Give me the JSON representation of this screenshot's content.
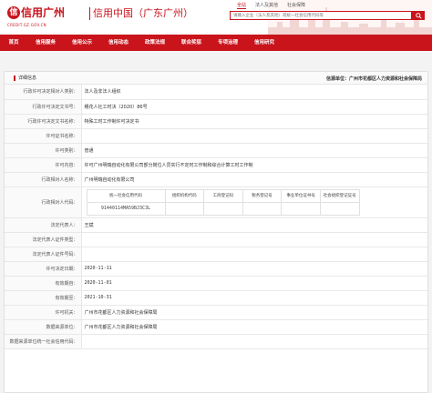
{
  "header": {
    "logo_char": "信",
    "logo_text": "信用广州",
    "logo_sub": "CREDIT.GZ.GOV.CN",
    "site_name": "信用中国（广东广州）",
    "top_tabs": [
      "全站",
      "法人及其他",
      "社会保障"
    ],
    "search_placeholder": "请输入企业（法人及其他）或统一社会信用代码等"
  },
  "nav": {
    "items": [
      "首页",
      "信用服务",
      "信用公示",
      "信用动态",
      "政策法规",
      "联合奖惩",
      "专项治理",
      "信用研究"
    ]
  },
  "panel": {
    "title": "详细信息",
    "unit": "信源单位：广州市花都区人力资源和社会保障局"
  },
  "rows": [
    {
      "label": "行政许可决定相对人类别：",
      "value": "法人及非法人组织"
    },
    {
      "label": "行政许可决定文书号：",
      "value": "穗花人社工时决（2020）86号"
    },
    {
      "label": "行政许可决定文书名称：",
      "value": "特殊工时工作制许可决定书"
    },
    {
      "label": "许可证书名称：",
      "value": ""
    },
    {
      "label": "许可类别：",
      "value": "普通"
    },
    {
      "label": "许可内容：",
      "value": "许可广州明瑞自动化有限公司部分岗位人员实行不定时工作制和综合计算工时工作制"
    },
    {
      "label": "行政相对人名称：",
      "value": "广州明瑞自动化有限公司"
    }
  ],
  "code_row": {
    "label": "行政相对人代码：",
    "headers": [
      "统一社会信用代码",
      "组织机构代码",
      "工商登记码",
      "税务登记号",
      "事业单位证书号",
      "社会组织登记证号"
    ],
    "values": [
      "91440114MA59BJ3C3L",
      "",
      "",
      "",
      "",
      ""
    ]
  },
  "rows2": [
    {
      "label": "法定代表人：",
      "value": "王斌"
    },
    {
      "label": "法定代表人证件类型：",
      "value": ""
    },
    {
      "label": "法定代表人证件号码：",
      "value": ""
    },
    {
      "label": "许可决定日期：",
      "value": "2020-11-11"
    },
    {
      "label": "有效期自：",
      "value": "2020-11-01"
    },
    {
      "label": "有效期至：",
      "value": "2021-10-31"
    },
    {
      "label": "许可机关：",
      "value": "广州市花都区人力资源和社会保障局"
    },
    {
      "label": "数据来源单位：",
      "value": "广州市花都区人力资源和社会保障局"
    },
    {
      "label": "数据来源单位统一社会信用代码：",
      "value": ""
    }
  ],
  "colors": {
    "brand": "#c9141c"
  }
}
